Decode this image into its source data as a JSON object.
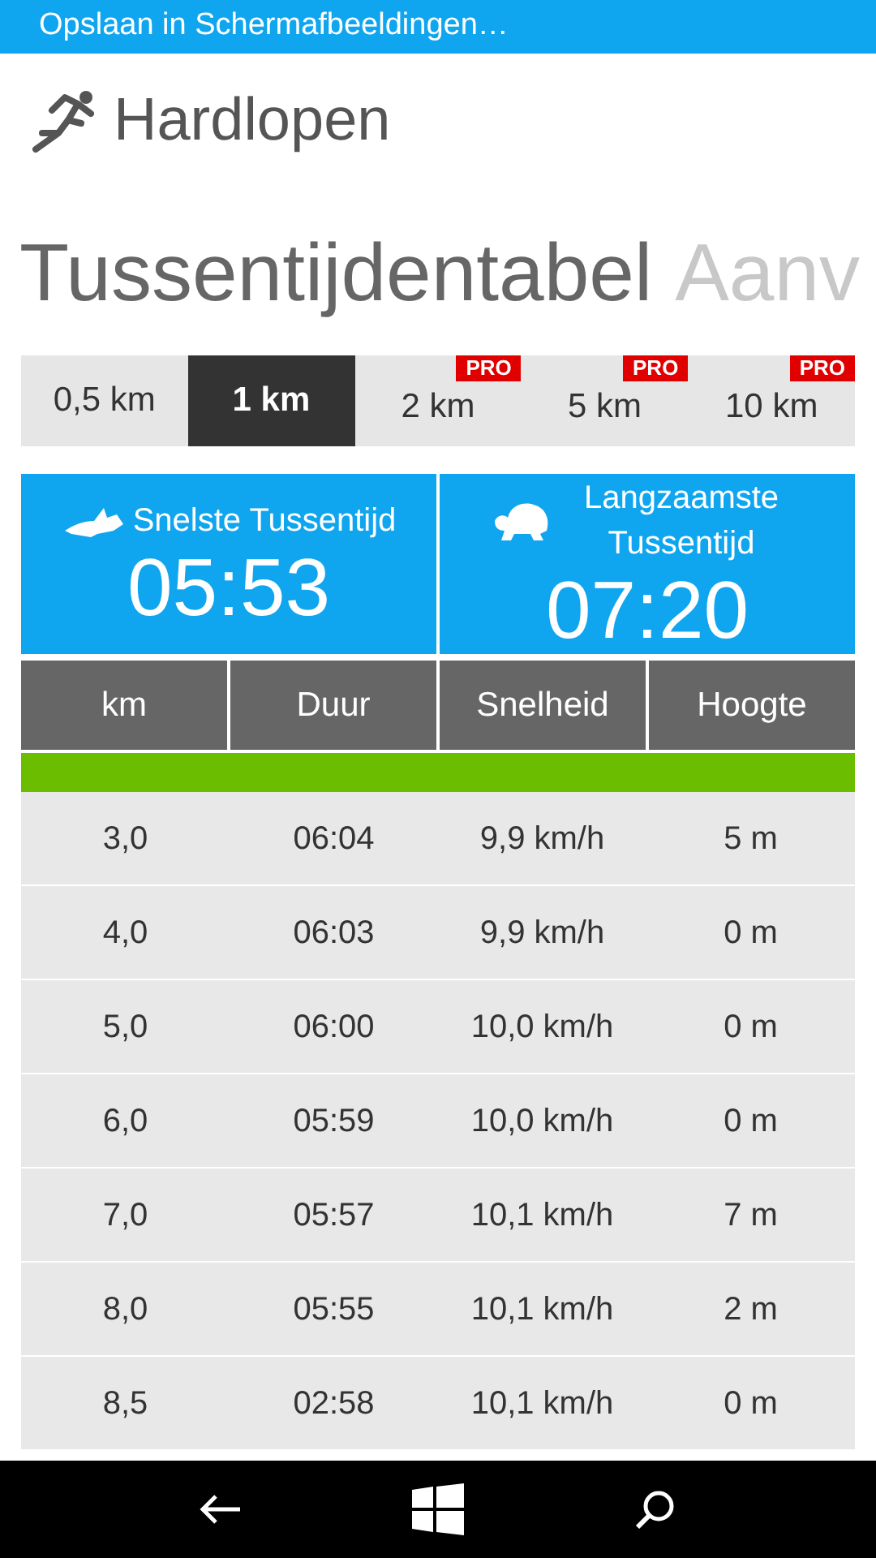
{
  "status_bar": {
    "text": "Opslaan in Schermafbeeldingen…"
  },
  "app": {
    "title": "Hardlopen"
  },
  "pivot": [
    {
      "label": "Tussentijdentabel",
      "selected": true
    },
    {
      "label": "Aanv",
      "selected": false
    }
  ],
  "tabs": [
    {
      "label": "0,5 km",
      "selected": false
    },
    {
      "label": "1 km",
      "selected": true
    },
    {
      "label": "2 km",
      "selected": false,
      "badge": "PRO"
    },
    {
      "label": "5 km",
      "selected": false,
      "badge": "PRO"
    },
    {
      "label": "10 km",
      "selected": false,
      "badge": "PRO"
    }
  ],
  "summary": [
    {
      "kind": "fastest",
      "label": "Snelste Tussentijd",
      "value": "05:53"
    },
    {
      "kind": "slowest",
      "label": "Langzaamste Tussentijd",
      "value": "07:20"
    }
  ],
  "table": {
    "columns": [
      "km",
      "Duur",
      "Snelheid",
      "Hoogte"
    ],
    "rows": [
      {
        "highlighted": true,
        "cells": []
      },
      {
        "highlighted": false,
        "cells": [
          "3,0",
          "06:04",
          "9,9 km/h",
          "5 m"
        ]
      },
      {
        "highlighted": false,
        "cells": [
          "4,0",
          "06:03",
          "9,9 km/h",
          "0 m"
        ]
      },
      {
        "highlighted": false,
        "cells": [
          "5,0",
          "06:00",
          "10,0 km/h",
          "0 m"
        ]
      },
      {
        "highlighted": false,
        "cells": [
          "6,0",
          "05:59",
          "10,0 km/h",
          "0 m"
        ]
      },
      {
        "highlighted": false,
        "cells": [
          "7,0",
          "05:57",
          "10,1 km/h",
          "7 m"
        ]
      },
      {
        "highlighted": false,
        "cells": [
          "8,0",
          "05:55",
          "10,1 km/h",
          "2 m"
        ]
      },
      {
        "highlighted": false,
        "cells": [
          "8,5",
          "02:58",
          "10,1 km/h",
          "0 m"
        ]
      }
    ]
  }
}
